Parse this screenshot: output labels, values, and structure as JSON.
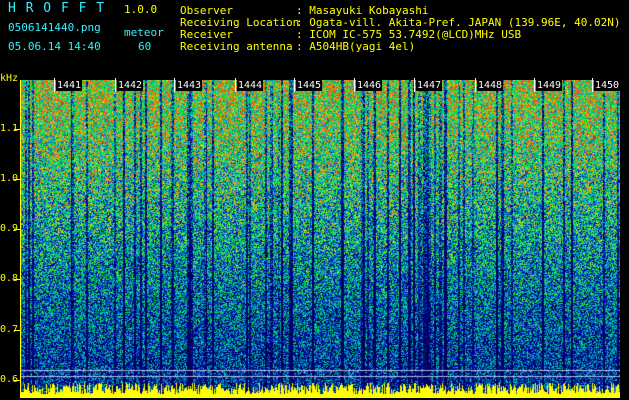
{
  "header": {
    "app_title": "H R O F F T",
    "version": "1.0.0",
    "file_name": "0506141440.png",
    "mode": "meteor",
    "datetime": "05.06.14 14:40",
    "count": "60"
  },
  "station": {
    "observer_label": "Observer",
    "observer_value": ": Masayuki Kobayashi",
    "location_label": "Receiving Location",
    "location_value": ": Ogata-vill. Akita-Pref. JAPAN (139.96E, 40.02N)",
    "receiver_label": "Receiver",
    "receiver_value": ": ICOM IC-575 53.7492(@LCD)MHz USB",
    "antenna_label": "Receiving antenna",
    "antenna_value": ": A504HB(yagi 4el)"
  },
  "axis": {
    "y_unit": "kHz",
    "y_ticks": [
      "1.1",
      "1.0",
      "0.9",
      "0.8",
      "0.7",
      "0.6"
    ],
    "time_labels": [
      "1441",
      "1442",
      "1443",
      "1444",
      "1445",
      "1446",
      "1447",
      "1448",
      "1449",
      "1450"
    ]
  },
  "colors": {
    "header_cyan": "#2ff2ff",
    "header_yellow": "#ffff00",
    "noise_floor": "#ffff00"
  }
}
